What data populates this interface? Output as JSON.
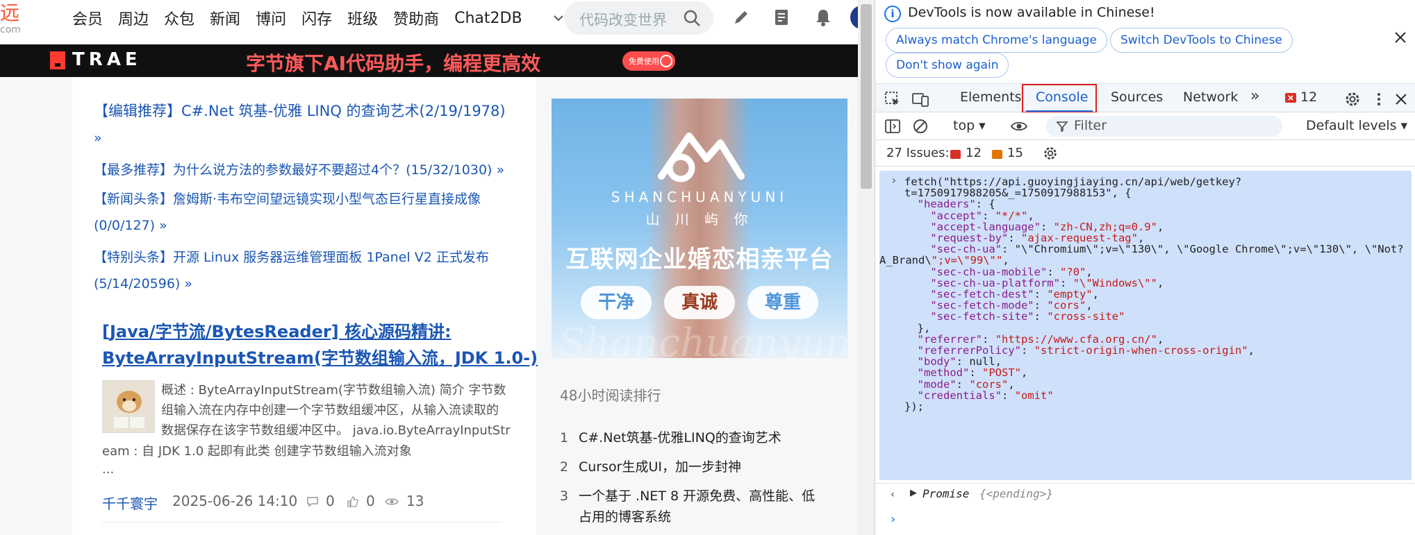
{
  "site": {
    "logo_fragment": "远",
    "logo_sub": "com",
    "nav": [
      "会员",
      "周边",
      "众包",
      "新闻",
      "博问",
      "闪存",
      "班级",
      "赞助商",
      "Chat2DB"
    ],
    "search_placeholder": "代码改变世界",
    "banner": {
      "brand": "TRAE",
      "slogan": "字节旗下AI代码助手，编程更高效",
      "cta": "免费使用"
    },
    "recommendations": [
      {
        "tag": "【编辑推荐】",
        "text": "C#.Net 筑基-优雅 LINQ 的查询艺术(2/19/1978)"
      },
      {
        "tag": "",
        "text": "»"
      },
      {
        "tag": "【最多推荐】",
        "text": "为什么说方法的参数最好不要超过4个？(15/32/1030) »"
      },
      {
        "tag": "【新闻头条】",
        "text": "詹姆斯·韦布空间望远镜实现小型气态巨行星直接成像"
      },
      {
        "tag": "",
        "text": "(0/0/127) »"
      },
      {
        "tag": "【特别头条】",
        "text": "开源 Linux 服务器运维管理面板 1Panel V2 正式发布"
      },
      {
        "tag": "",
        "text": "(5/14/20596) »"
      }
    ],
    "article": {
      "title_line1": "[Java/字节流/BytesReader] 核心源码精讲:",
      "title_line2": "ByteArrayInputStream(字节数组输入流，JDK 1.0-)",
      "excerpt_lines": [
        "概述 : ByteArrayInputStream(字节数组输入流) 简介 字节数",
        "组输入流在内存中创建一个字节数组缓冲区，从输入流读取的",
        "数据保存在该字节数组缓冲区中。 java.io.ByteArrayInputStr",
        "eam : 自 JDK 1.0 起即有此类 创建字节数组输入流对象",
        "..."
      ],
      "author": "千千寰宇",
      "date": "2025-06-26 14:10",
      "comments": "0",
      "likes": "0",
      "views": "13"
    },
    "ad": {
      "brand_en": "SHANCHUANYUNI",
      "brand_zh": "山 川 屿 你",
      "headline": "互联网企业婚恋相亲平台",
      "pills": [
        "干净",
        "真诚",
        "尊重"
      ],
      "watermark": "Shanchuanyuni"
    },
    "ranking": {
      "title": "48小时阅读排行",
      "items": [
        {
          "n": "1",
          "text": "C#.Net筑基-优雅LINQ的查询艺术"
        },
        {
          "n": "2",
          "text": "Cursor生成UI，加一步封神"
        },
        {
          "n": "3",
          "text": "一个基于 .NET 8 开源免费、高性能、低"
        },
        {
          "n": "",
          "text": "占用的博客系统"
        }
      ]
    }
  },
  "devtools": {
    "info_message": "DevTools is now available in Chinese!",
    "chips": [
      "Always match Chrome's language",
      "Switch DevTools to Chinese",
      "Don't show again"
    ],
    "tabs": [
      "Elements",
      "Console",
      "Sources",
      "Network"
    ],
    "active_tab": "Console",
    "more_tabs": "»",
    "error_count": "12",
    "context": "top",
    "filter_placeholder": "Filter",
    "levels": "Default levels",
    "issues_label": "27 Issues:",
    "issues_errors": "12",
    "issues_warnings": "15",
    "code_lines": [
      "fetch(\"https://api.guoyingjiaying.cn/api/web/getkey?",
      "t=1750917988205&_=1750917988153\", {",
      "  \"headers\": {",
      "    \"accept\": \"*/*\",",
      "    \"accept-language\": \"zh-CN,zh;q=0.9\",",
      "    \"request-by\": \"ajax-request-tag\",",
      "    \"sec-ch-ua\": \"\\\"Chromium\\\";v=\\\"130\\\", \\\"Google Chrome\\\";v=\\\"130\\\", \\\"Not?",
      "A_Brand\\\";v=\\\"99\\\"\",",
      "    \"sec-ch-ua-mobile\": \"?0\",",
      "    \"sec-ch-ua-platform\": \"\\\"Windows\\\"\",",
      "    \"sec-fetch-dest\": \"empty\",",
      "    \"sec-fetch-mode\": \"cors\",",
      "    \"sec-fetch-site\": \"cross-site\"",
      "  },",
      "  \"referrer\": \"https://www.cfa.org.cn/\",",
      "  \"referrerPolicy\": \"strict-origin-when-cross-origin\",",
      "  \"body\": null,",
      "  \"method\": \"POST\",",
      "  \"mode\": \"cors\",",
      "  \"credentials\": \"omit\"",
      "});"
    ],
    "result_type": "Promise",
    "result_state": "{<pending>}",
    "colors": {
      "accent": "#1a73e8",
      "error": "#d93025",
      "warning": "#e37400",
      "highlight": "#e02020",
      "code_bg": "#cfe0fb"
    }
  }
}
